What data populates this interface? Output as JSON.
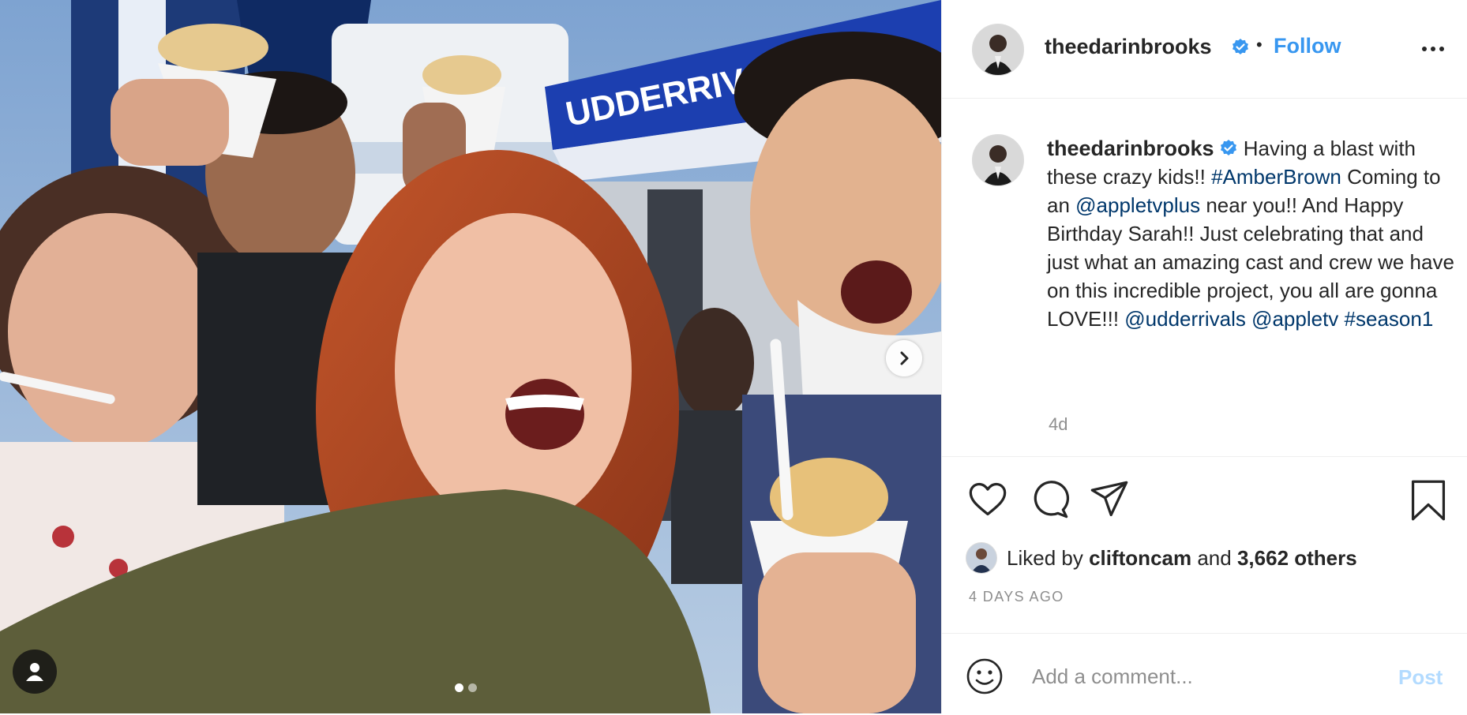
{
  "post": {
    "username": "theedarinbrooks",
    "verified": true,
    "separator": "•",
    "follow_label": "Follow",
    "more_icon": "more-horizontal-icon",
    "caption": {
      "username": "theedarinbrooks",
      "t1": "Having a blast with these crazy kids!!",
      "hashtag1": "#AmberBrown",
      "t2": "Coming to an",
      "mention1": "@appletvplus",
      "t3": "near you!! And Happy Birthday Sarah!! Just celebrating that and just what an amazing cast and crew we have on this incredible project, you all are gonna LOVE!!!",
      "mention2": "@udderrivals",
      "mention3": "@appletv",
      "hashtag2": "#season1"
    },
    "relative_time": "4d",
    "likes": {
      "prefix": "Liked by",
      "liker": "cliftoncam",
      "and": "and",
      "others": "3,662 others"
    },
    "date": "4 DAYS AGO",
    "comment": {
      "placeholder": "Add a comment...",
      "post_label": "Post"
    }
  },
  "media": {
    "banner_text": "UDDERRIVALS.CO",
    "carousel": {
      "current": 1,
      "total": 2
    }
  },
  "colors": {
    "link": "#00376b",
    "follow": "#3897f0",
    "post_disabled": "#b3dbff",
    "secondary_text": "#8e8e8e",
    "verified_badge": "#3897f0"
  }
}
